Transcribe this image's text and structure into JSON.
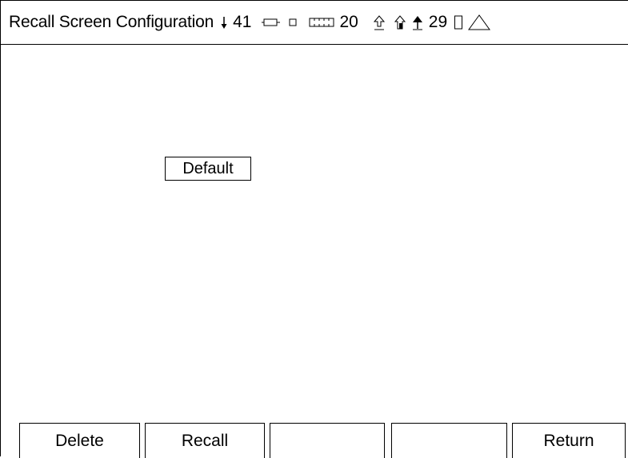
{
  "header": {
    "title": "Recall Screen Configuration",
    "status": {
      "channel_a": "41",
      "channel_b": "20",
      "channel_c": "29"
    }
  },
  "main": {
    "configurations": [
      {
        "label": "Default"
      }
    ]
  },
  "softkeys": [
    {
      "label": "Delete"
    },
    {
      "label": "Recall"
    },
    {
      "label": ""
    },
    {
      "label": ""
    },
    {
      "label": "Return"
    }
  ],
  "icons": [
    "arrow-down-icon",
    "battery-icon",
    "small-square-icon",
    "segmented-bar-icon",
    "outline-up-arrow-icon",
    "house-up-arrow-icon",
    "filled-up-arrow-icon",
    "empty-rectangle-icon",
    "warning-triangle-icon"
  ]
}
